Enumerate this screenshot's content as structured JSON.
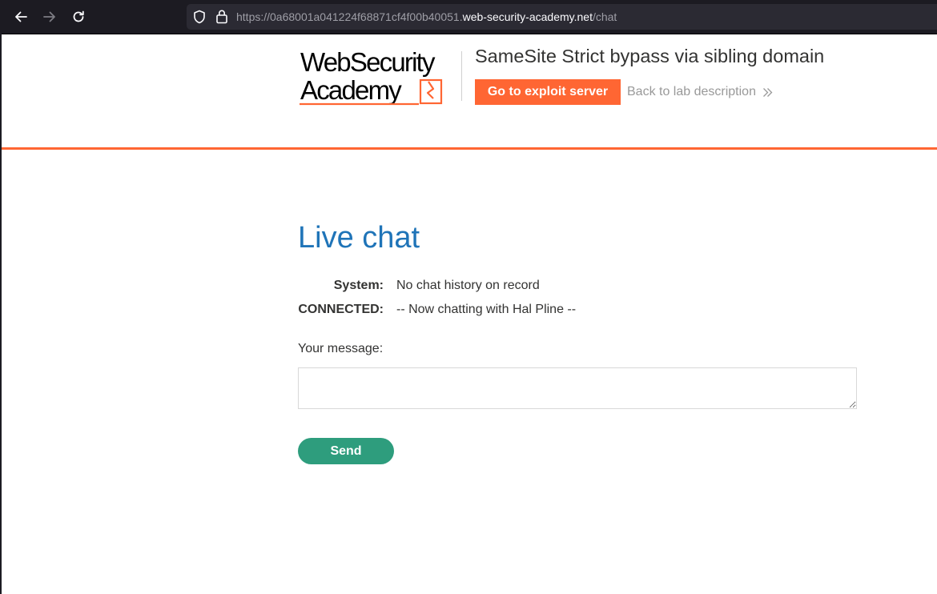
{
  "browser": {
    "url_prefix": "https://0a68001a041224f68871cf4f00b40051.",
    "url_host": "web-security-academy.net",
    "url_path": "/chat",
    "icons": [
      "back-arrow-icon",
      "forward-arrow-icon",
      "reload-icon",
      "shield-icon",
      "lock-icon"
    ]
  },
  "header": {
    "logo": {
      "line1": "WebSecurity",
      "line2": "Academy"
    },
    "lab_title": "SameSite Strict bypass via sibling domain",
    "exploit_button": "Go to exploit server",
    "back_link": "Back to lab description",
    "accent_color": "#ff6633"
  },
  "main": {
    "title": "Live chat",
    "title_color": "#1f74b8",
    "chat": [
      {
        "who": "System:",
        "message": "No chat history on record"
      },
      {
        "who": "CONNECTED:",
        "message": "-- Now chatting with Hal Pline --"
      }
    ],
    "message_label": "Your message:",
    "message_value": "",
    "send_button": "Send",
    "send_color": "#2e9d7d"
  }
}
